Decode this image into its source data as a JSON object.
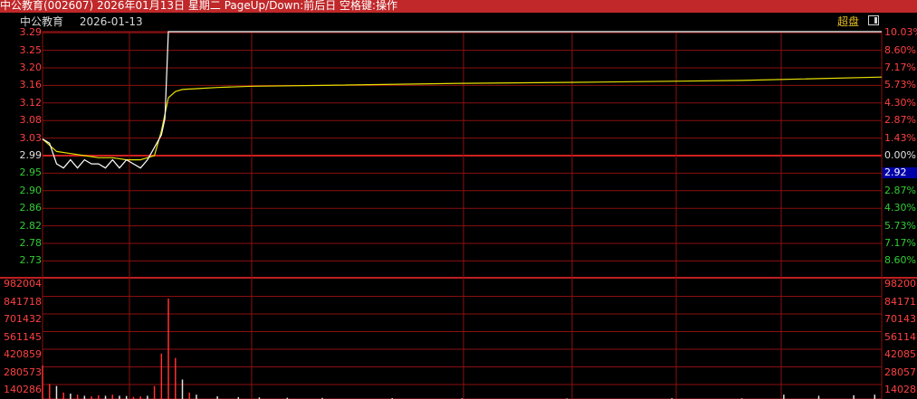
{
  "window": {
    "title": "中公教育(002607) 2026年01月13日 星期二 PageUp/Down:前后日 空格键:操作"
  },
  "chart_header": {
    "stock_name": "中公教育",
    "date": "2026-01-13",
    "super_button": "超盘",
    "toggle_icon": "panel-toggle-icon"
  },
  "price_axis": {
    "up_labels": [
      "3.29",
      "3.25",
      "3.20",
      "3.16",
      "3.12",
      "3.08",
      "3.03"
    ],
    "base_label": "2.99",
    "down_labels": [
      "2.95",
      "2.90",
      "2.86",
      "2.82",
      "2.78",
      "2.73"
    ]
  },
  "percent_axis": {
    "up_labels": [
      "10.03%",
      "8.60%",
      "7.17%",
      "5.73%",
      "4.30%",
      "2.87%",
      "1.43%"
    ],
    "base_label": "0.00%",
    "current_price": "2.92",
    "down_labels": [
      "2.87%",
      "4.30%",
      "5.73%",
      "7.17%",
      "8.60%"
    ]
  },
  "volume_axis": {
    "left_labels": [
      "982004",
      "841718",
      "701432",
      "561145",
      "420859",
      "280573",
      "140286"
    ],
    "right_labels": [
      "98200",
      "84171",
      "70143",
      "56114",
      "42085",
      "28057",
      "14028"
    ]
  },
  "colors": {
    "grid": "#8b1010",
    "axis_frame": "#b01818",
    "price_line": "#ffffff",
    "avg_line": "#e8e000",
    "up": "#ff3030",
    "down": "#33cc33",
    "title_bar": "#c0282a"
  },
  "chart_data": {
    "type": "line",
    "title": "",
    "xlabel": "",
    "ylabel": "",
    "ylim": [
      2.69,
      3.29
    ],
    "base_price": 2.99,
    "series": [
      {
        "x": [
          0,
          2,
          4,
          6,
          8,
          10,
          12,
          14,
          16,
          18,
          20,
          22,
          24,
          26,
          28,
          30,
          32,
          34,
          35,
          36,
          37,
          38,
          40,
          44,
          50,
          60,
          80,
          120,
          180,
          240
        ],
        "values": [
          3.03,
          3.02,
          2.97,
          2.96,
          2.98,
          2.96,
          2.98,
          2.97,
          2.97,
          2.96,
          2.98,
          2.96,
          2.98,
          2.97,
          2.96,
          2.98,
          3.01,
          3.04,
          3.08,
          3.29,
          3.29,
          3.29,
          3.29,
          3.29,
          3.29,
          3.29,
          3.29,
          3.29,
          3.29,
          3.29
        ]
      },
      {
        "x": [
          0,
          4,
          8,
          12,
          16,
          20,
          24,
          28,
          30,
          32,
          34,
          36,
          38,
          40,
          44,
          50,
          60,
          80,
          120,
          160,
          200,
          240
        ],
        "values": [
          3.03,
          3.0,
          2.995,
          2.99,
          2.985,
          2.985,
          2.98,
          2.98,
          2.985,
          2.99,
          3.05,
          3.13,
          3.145,
          3.15,
          3.152,
          3.155,
          3.158,
          3.16,
          3.165,
          3.168,
          3.172,
          3.18
        ]
      }
    ],
    "volume": {
      "ylim": [
        0,
        1122290
      ],
      "x": [
        0,
        2,
        4,
        6,
        8,
        10,
        12,
        14,
        16,
        18,
        20,
        22,
        24,
        26,
        28,
        30,
        32,
        34,
        36,
        38,
        40,
        42,
        44,
        50,
        56,
        62,
        70,
        80,
        100,
        120,
        150,
        180,
        200,
        212,
        222,
        232,
        238
      ],
      "values": [
        310000,
        140000,
        120000,
        60000,
        50000,
        40000,
        30000,
        25000,
        35000,
        30000,
        40000,
        30000,
        28000,
        20000,
        25000,
        30000,
        120000,
        420000,
        930000,
        380000,
        180000,
        60000,
        40000,
        25000,
        18000,
        15000,
        12000,
        10000,
        8000,
        6000,
        5000,
        7000,
        6000,
        40000,
        30000,
        35000,
        40000
      ],
      "up_flags": [
        true,
        true,
        false,
        true,
        false,
        true,
        false,
        true,
        true,
        false,
        true,
        false,
        false,
        true,
        true,
        false,
        true,
        true,
        true,
        true,
        false,
        true,
        false,
        false,
        false,
        false,
        false,
        false,
        false,
        false,
        false,
        false,
        false,
        false,
        false,
        false,
        false
      ]
    }
  }
}
